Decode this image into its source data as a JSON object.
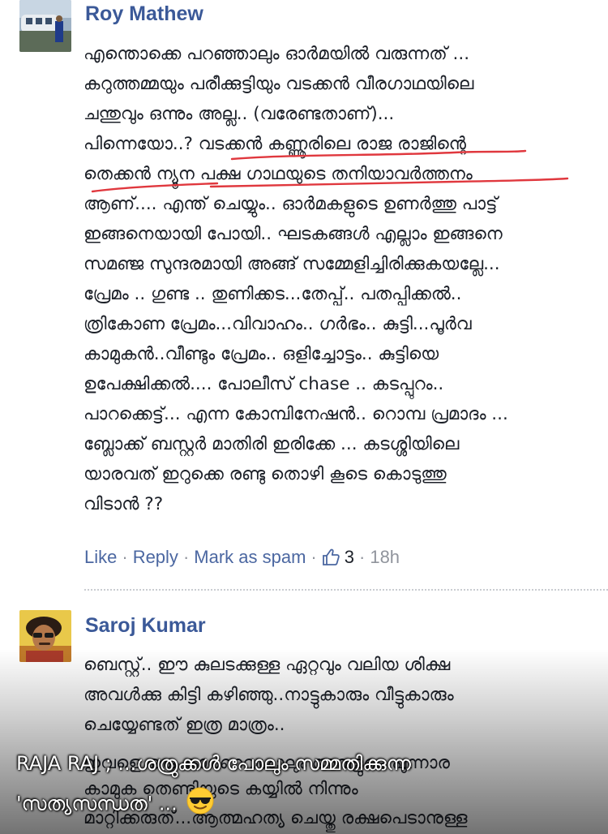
{
  "comment1": {
    "author": "Roy Mathew",
    "lines": [
      "എന്തൊക്കെ പറഞ്ഞാലും ഓർമയിൽ വരുന്നത് ...",
      "കറുത്തമ്മയും പരീക്കുട്ടിയും വടക്കൻ വീരഗാഥയിലെ",
      "ചന്തുവും ഒന്നും അല്ല.. (വരേണ്ടതാണ്)...",
      "പിന്നെയോ..? വടക്കൻ കണ്ണൂരിലെ രാജ രാജിന്റെ",
      "തെക്കൻ ന്യൂന പക്ഷ ഗാഥയുടെ തനിയാവർത്തനം",
      "ആണ്.... എന്ത് ചെയ്യും.. ഓർമകളുടെ ഉണർത്തു പാട്ട്",
      "ഇങ്ങനെയായി പോയി.. ഘടകങ്ങൾ എല്ലാം ഇങ്ങനെ",
      "സമഞ്ജ സുന്ദരമായി അങ്ങ് സമ്മേളിച്ചിരിക്കുകയല്ലേ...",
      "പ്രേമം .. ഗുണ്ട .. തുണിക്കട...തേപ്പ്.. പതപ്പിക്കൽ..",
      "ത്രികോണ പ്രേമം...വിവാഹം.. ഗർഭം.. കുട്ടി...പൂർവ",
      "കാമുകൻ..വീണ്ടും പ്രേമം.. ഒളിച്ചോട്ടം.. കുട്ടിയെ",
      "ഉപേക്ഷിക്കൽ.... പോലീസ് chase .. കടപ്പുറം..",
      "പാറക്കെട്ട്... എന്ന കോമ്പിനേഷൻ.. റൊമ്പ പ്രമാദം ...",
      "ബ്ലോക്ക് ബസ്റ്റർ മാതിരി ഇരിക്കേ ... കടശ്ശിയിലെ",
      "യാരവത് ഇറുക്കെ രണ്ടു തൊഴി കൂടെ കൊടുത്തു",
      "വിടാൻ ??"
    ],
    "actions": {
      "like": "Like",
      "reply": "Reply",
      "spam": "Mark as spam",
      "sep": "·",
      "like_count": "3",
      "time": "18h"
    }
  },
  "comment2": {
    "author": "Saroj Kumar",
    "lines": [
      "ബെസ്റ്റ്.. ഈ കുലടക്കുള്ള ഏറ്റവും വലിയ ശിക്ഷ",
      "അവൾക്കു കിട്ടി കഴിഞ്ഞു..നാട്ടുകാരും വീട്ടുകാരും",
      "ചെയ്യേണ്ടത് ഇത്ര മാത്രം..",
      "ഇവളെ ഒരു കാരണവശാലും അവളുടെ പുന്നാര",
      "കാമുക തെണ്ടിയുടെ കയ്യിൽ നിന്നും",
      "മാറ്റിക്കരുത്...ആത്മഹത്യ ചെയ്തു രക്ഷപെടാനുള്ള"
    ]
  },
  "overlay_caption": {
    "line1": "RAJA RAJ ;  ...ശത്രുക്കൾ പോലും സമ്മതിക്കുന്ന",
    "line2": "'സത്യസന്ധത' ...",
    "emoji": "sunglasses-emoji"
  },
  "colors": {
    "author": "#3b5998",
    "action_link": "#4b67a1",
    "underline": "#e0383e",
    "meta_grey": "#90949c"
  }
}
